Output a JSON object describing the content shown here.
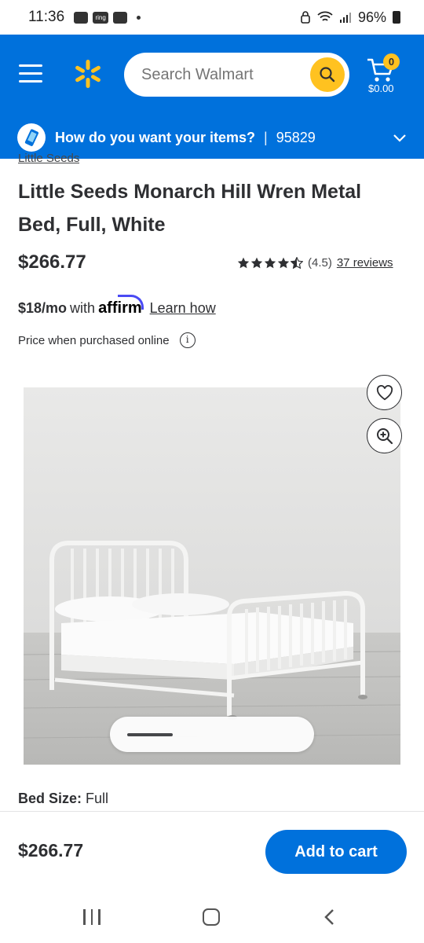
{
  "status_bar": {
    "time": "11:36",
    "ring_label": "ring",
    "battery": "96%"
  },
  "header": {
    "search_placeholder": "Search Walmart",
    "cart_count": "0",
    "cart_total": "$0.00"
  },
  "delivery": {
    "prompt": "How do you want your items?",
    "separator": "|",
    "zip": "95829"
  },
  "product": {
    "brand": "Little Seeds",
    "title": "Little Seeds Monarch Hill Wren Metal Bed, Full, White",
    "price": "$266.77",
    "rating_value": 4.5,
    "rating_text": "(4.5)",
    "reviews": "37 reviews",
    "affirm_monthly": "$18/mo",
    "affirm_with": "with",
    "affirm_brand": "affirm",
    "affirm_learn": "Learn how",
    "price_note": "Price when purchased online",
    "info_glyph": "i",
    "bed_size_label": "Bed Size:",
    "bed_size_value": "Full"
  },
  "bottom_bar": {
    "price": "$266.77",
    "add_to_cart": "Add to cart"
  },
  "colors": {
    "brand_blue": "#0071dc",
    "spark_yellow": "#ffc220"
  }
}
